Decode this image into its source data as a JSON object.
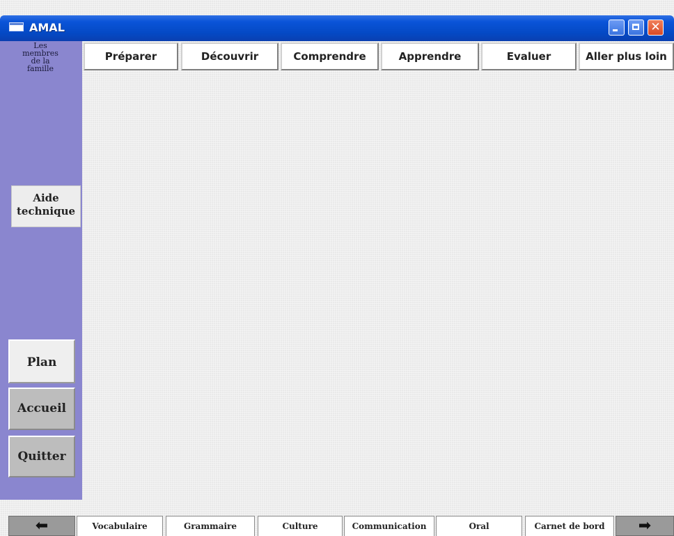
{
  "window": {
    "title": "AMAL",
    "minimize_icon": "minimize-icon",
    "maximize_icon": "maximize-icon",
    "close_icon": "close-icon",
    "close_glyph": "✕"
  },
  "sidebar": {
    "lesson_title_lines": [
      "Les",
      "membres",
      "de la",
      "famille"
    ],
    "aide_technique": [
      "Aide",
      "technique"
    ],
    "plan": "Plan",
    "accueil": "Accueil",
    "quitter": "Quitter"
  },
  "top_tabs": [
    {
      "label": "Préparer"
    },
    {
      "label": "Découvrir"
    },
    {
      "label": "Comprendre"
    },
    {
      "label": "Apprendre"
    },
    {
      "label": "Evaluer"
    },
    {
      "label": "Aller plus loin"
    }
  ],
  "bottom_nav": {
    "prev_icon": "arrow-left-icon",
    "next_icon": "arrow-right-icon",
    "prev_glyph": "⬅",
    "next_glyph": "➡",
    "tabs": [
      {
        "label": "Vocabulaire"
      },
      {
        "label": "Grammaire"
      },
      {
        "label": "Culture"
      },
      {
        "label": "Communication"
      },
      {
        "label": "Oral"
      },
      {
        "label": "Carnet de bord"
      }
    ]
  },
  "colors": {
    "titlebar": "#0449c4",
    "sidebar": "#8a86cf",
    "content_background": "#e9e9e9"
  }
}
